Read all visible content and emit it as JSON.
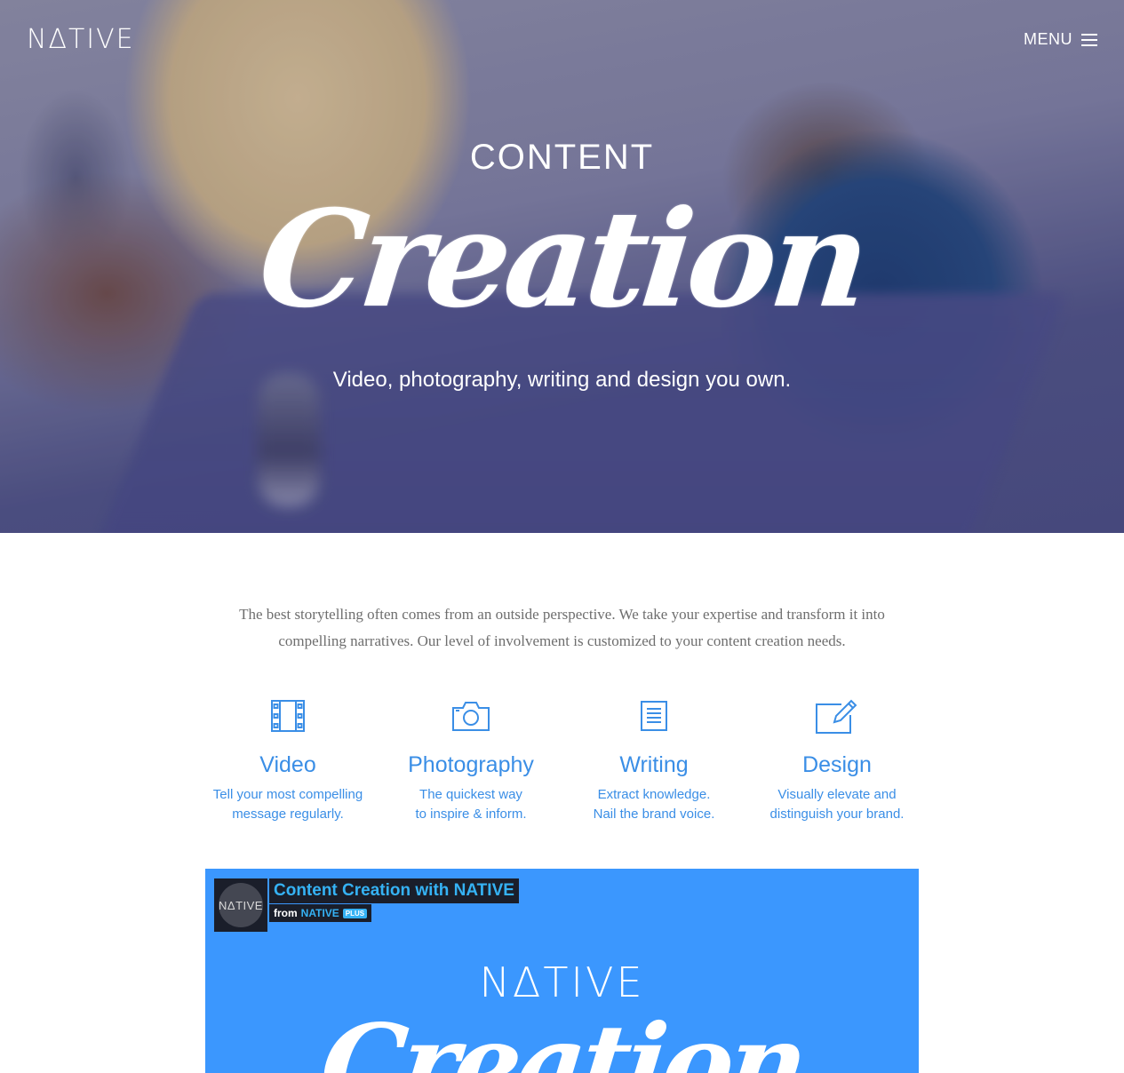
{
  "header": {
    "logo": "NΔTIVE",
    "menu_label": "MENU"
  },
  "hero": {
    "kicker": "CONTENT",
    "script_title": "Creation",
    "subtitle": "Video, photography, writing and design you own."
  },
  "intro": {
    "text": "The best storytelling often comes from an outside perspective. We take your expertise and transform it into compelling narratives. Our level of involvement is customized to your content creation needs."
  },
  "services": [
    {
      "icon": "film-icon",
      "title": "Video",
      "line1": "Tell your most compelling",
      "line2": "message regularly."
    },
    {
      "icon": "camera-icon",
      "title": "Photography",
      "line1": "The quickest way",
      "line2": "to inspire & inform."
    },
    {
      "icon": "document-icon",
      "title": "Writing",
      "line1": "Extract knowledge.",
      "line2": "Nail the brand voice."
    },
    {
      "icon": "edit-icon",
      "title": "Design",
      "line1": "Visually elevate and",
      "line2": "distinguish your brand."
    }
  ],
  "video": {
    "avatar_text": "NΔTIVE",
    "title": "Content Creation with NATIVE",
    "from_label": "from",
    "from_name": "NATIVE",
    "badge": "PLUS",
    "logo": "NΔTIVE",
    "script": "Creation"
  },
  "colors": {
    "accent": "#3a8ee6",
    "video_bg": "#3b97fe",
    "intro_text": "#6e6e6e"
  }
}
